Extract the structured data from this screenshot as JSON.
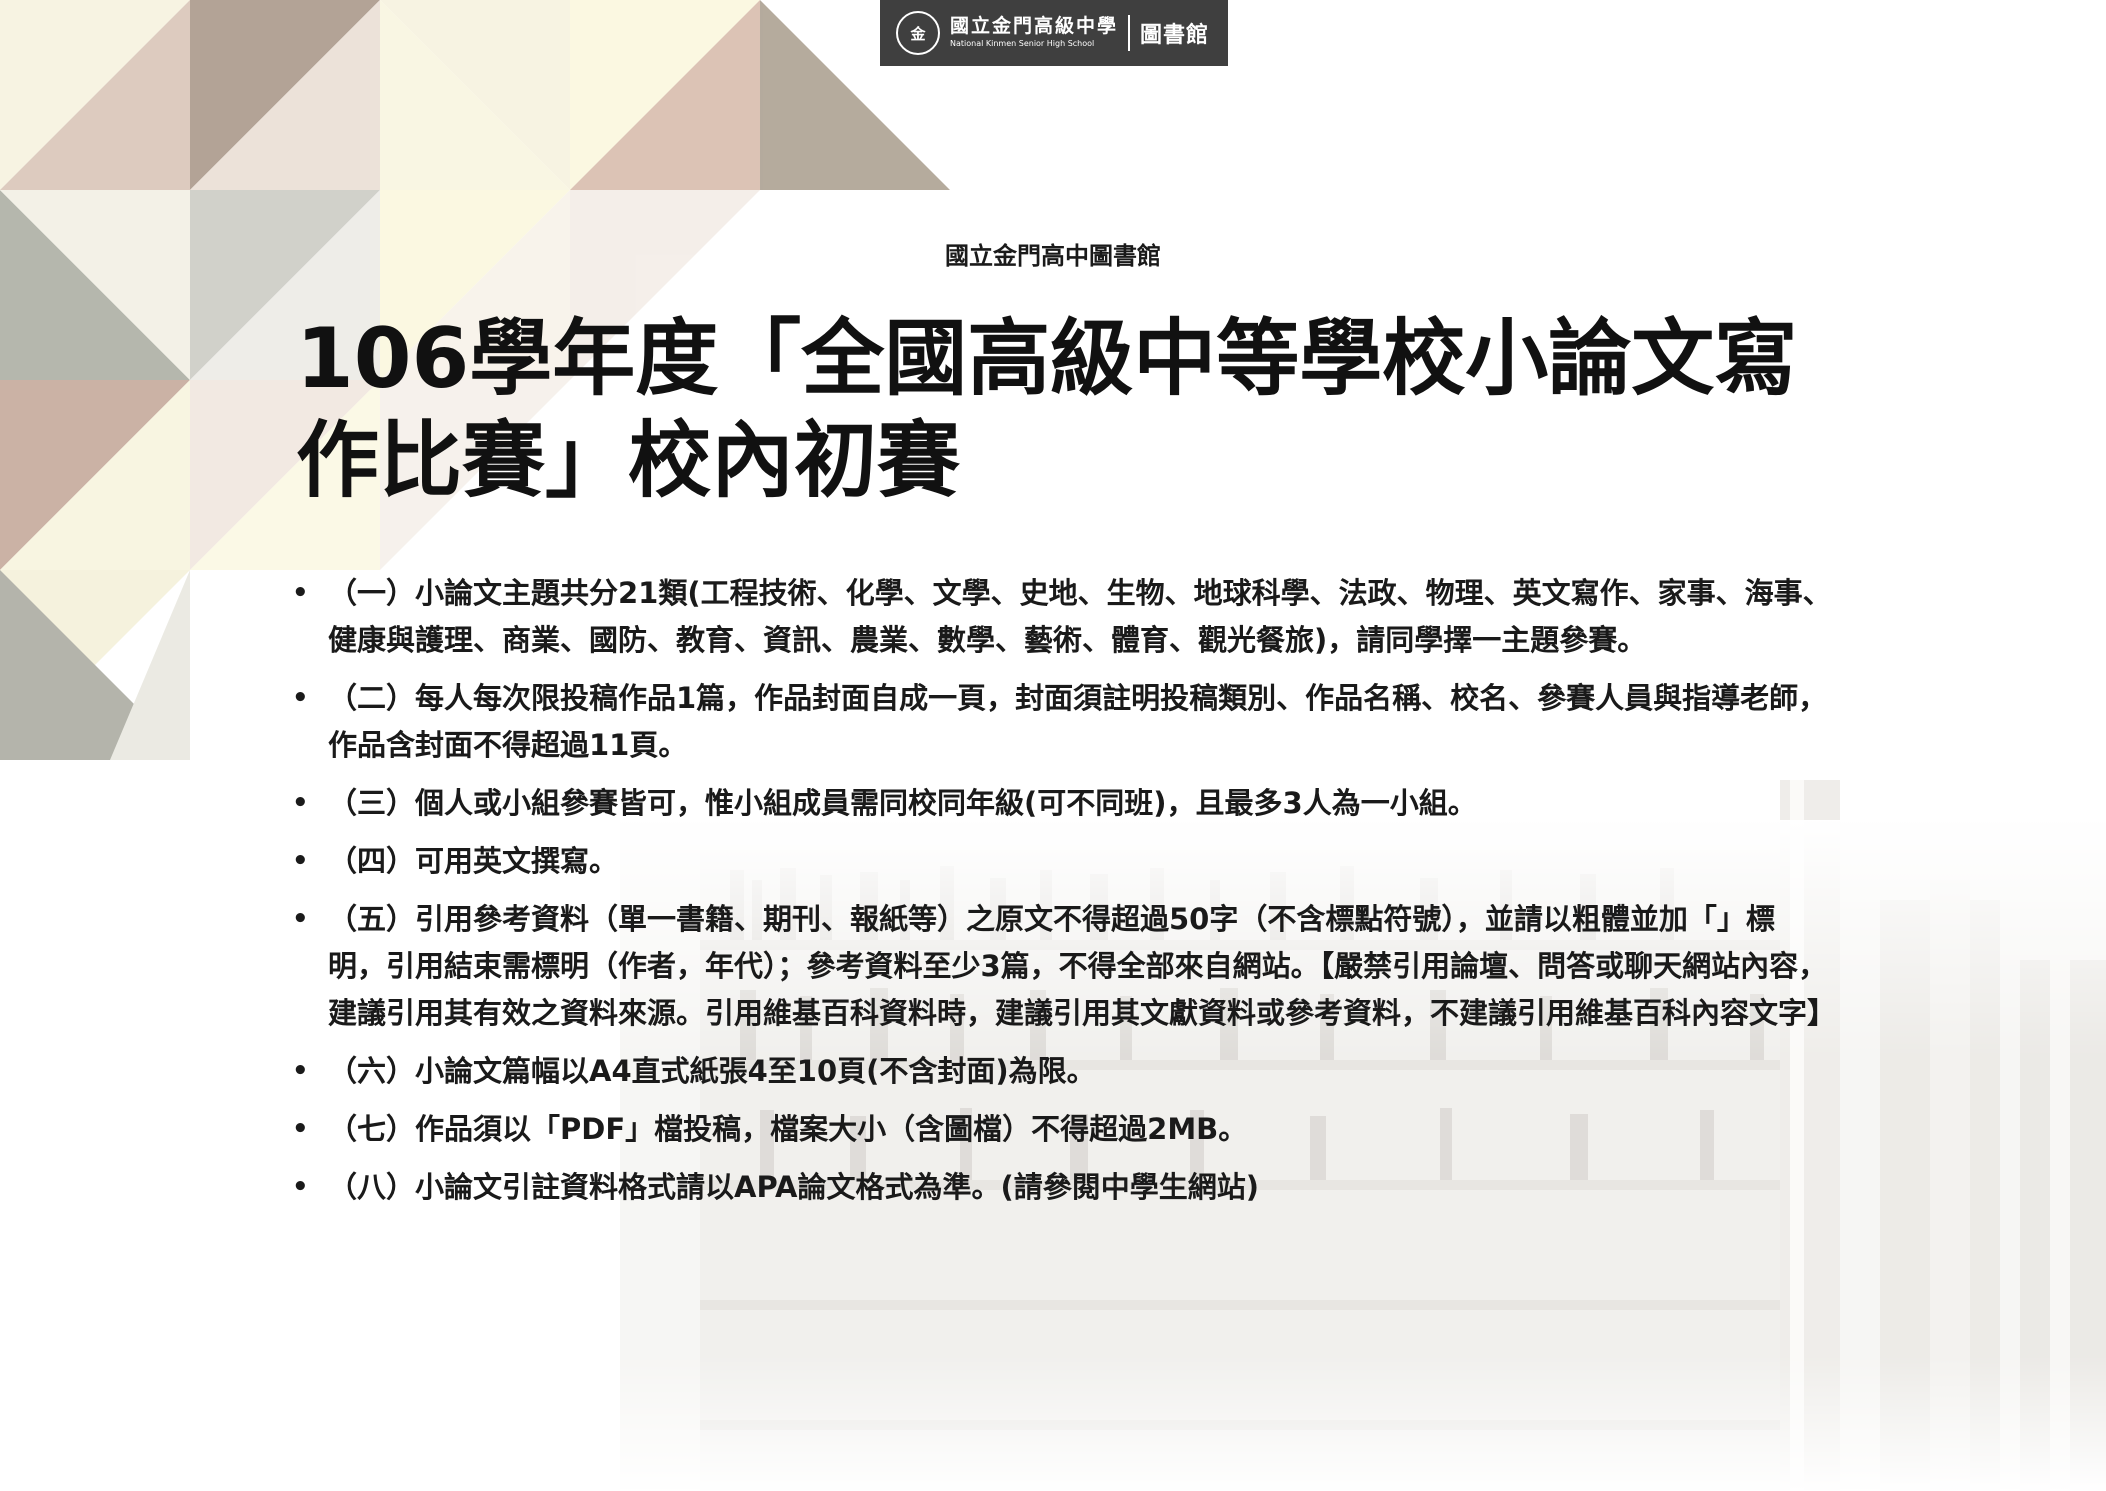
{
  "header": {
    "school_name": "國立金門高級中學",
    "school_name_en": "National Kinmen Senior High School",
    "department": "圖書館",
    "emblem_icon": "school-emblem-icon"
  },
  "subtitle": "國立金門高中圖書館",
  "title": "106學年度「全國高級中等學校小論文寫作比賽」校內初賽",
  "bullet_symbol": "•",
  "items": [
    "（一）小論文主題共分21類(工程技術、化學、文學、史地、生物、地球科學、法政、物理、英文寫作、家事、海事、健康與護理、商業、國防、教育、資訊、農業、數學、藝術、體育、觀光餐旅)，請同學擇一主題參賽。",
    "（二）每人每次限投稿作品1篇，作品封面自成一頁，封面須註明投稿類別、作品名稱、校名、參賽人員與指導老師，作品含封面不得超過11頁。",
    "（三）個人或小組參賽皆可，惟小組成員需同校同年級(可不同班)，且最多3人為一小組。",
    "（四）可用英文撰寫。",
    "（五）引用參考資料（單一書籍、期刊、報紙等）之原文不得超過50字（不含標點符號），並請以粗體並加「」標明，引用結束需標明（作者，年代）；參考資料至少3篇，不得全部來自網站。【嚴禁引用論壇、問答或聊天網站內容，建議引用其有效之資料來源。引用維基百科資料時，建議引用其文獻資料或參考資料，不建議引用維基百科內容文字】",
    "（六）小論文篇幅以A4直式紙張4至10頁(不含封面)為限。",
    "（七）作品須以「PDF」檔投稿，檔案大小（含圖檔）不得超過2MB。",
    "（八）小論文引註資料格式請以APA論文格式為準。(請參閱中學生網站)"
  ],
  "colors": {
    "mauve": "#c8ab9c",
    "taupe": "#aa9a88",
    "cream": "#fbf8dc",
    "sage": "#bcbcb0",
    "badge_bg": "#3f3f3f"
  }
}
